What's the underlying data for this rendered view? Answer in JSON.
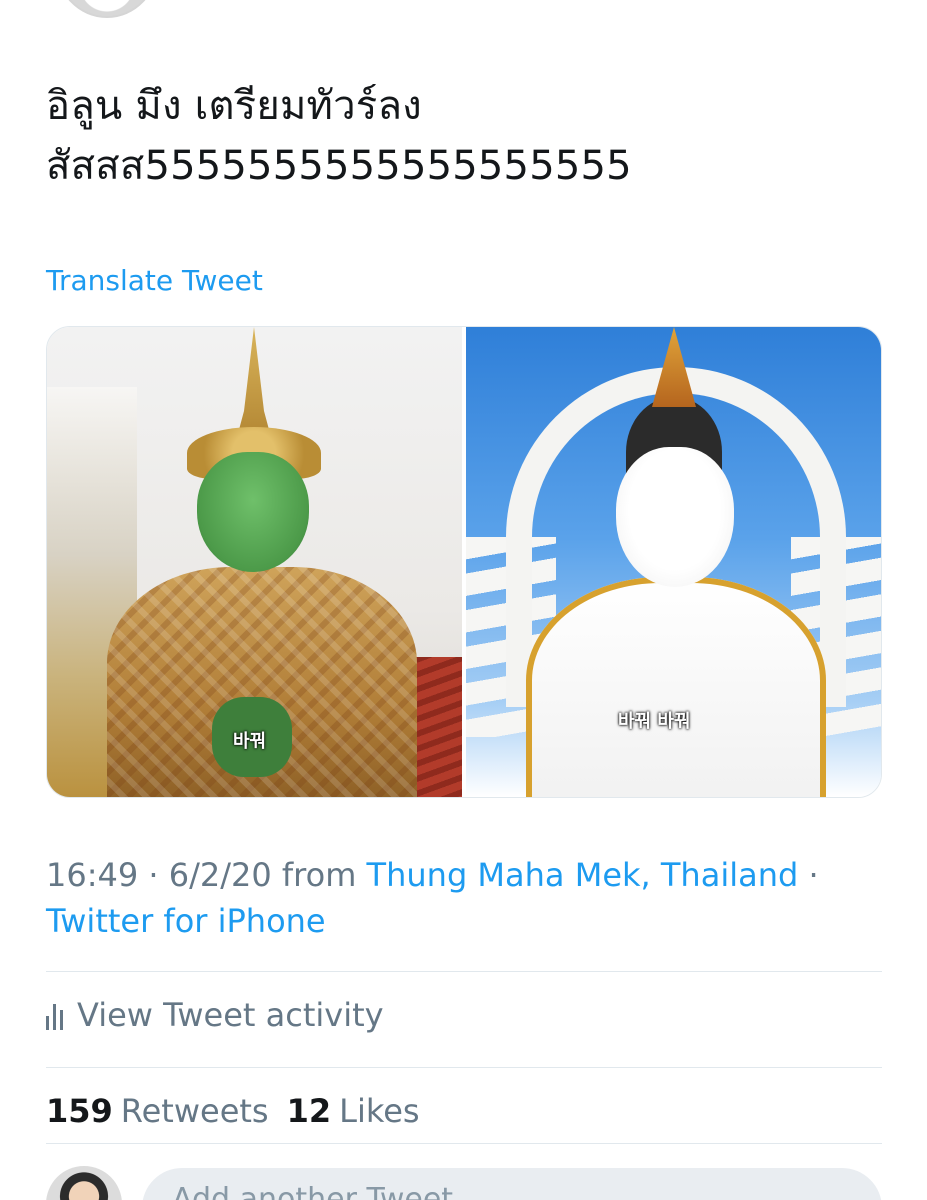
{
  "tweet": {
    "text_line1": "อิลูน มึง เตรียมทัวร์ลง",
    "text_line2": "สัสสส5555555555555555555",
    "translate_label": "Translate Tweet",
    "media": {
      "left_caption": "바꿔",
      "right_caption": "바꿔 바꿔"
    },
    "meta": {
      "time": "16:49",
      "date": "6/2/20",
      "from_label": "from",
      "location": "Thung Maha Mek, Thailand",
      "separator": "·",
      "client": "Twitter for iPhone"
    },
    "activity_label": "View Tweet activity",
    "stats": {
      "retweets_count": "159",
      "retweets_label": "Retweets",
      "likes_count": "12",
      "likes_label": "Likes"
    },
    "reply_placeholder": "Add another Tweet"
  },
  "colors": {
    "link": "#1d9bf0",
    "muted": "#657786",
    "text": "#14171a",
    "divider": "#e1e8ed"
  },
  "icons": [
    "bar-chart-icon"
  ]
}
